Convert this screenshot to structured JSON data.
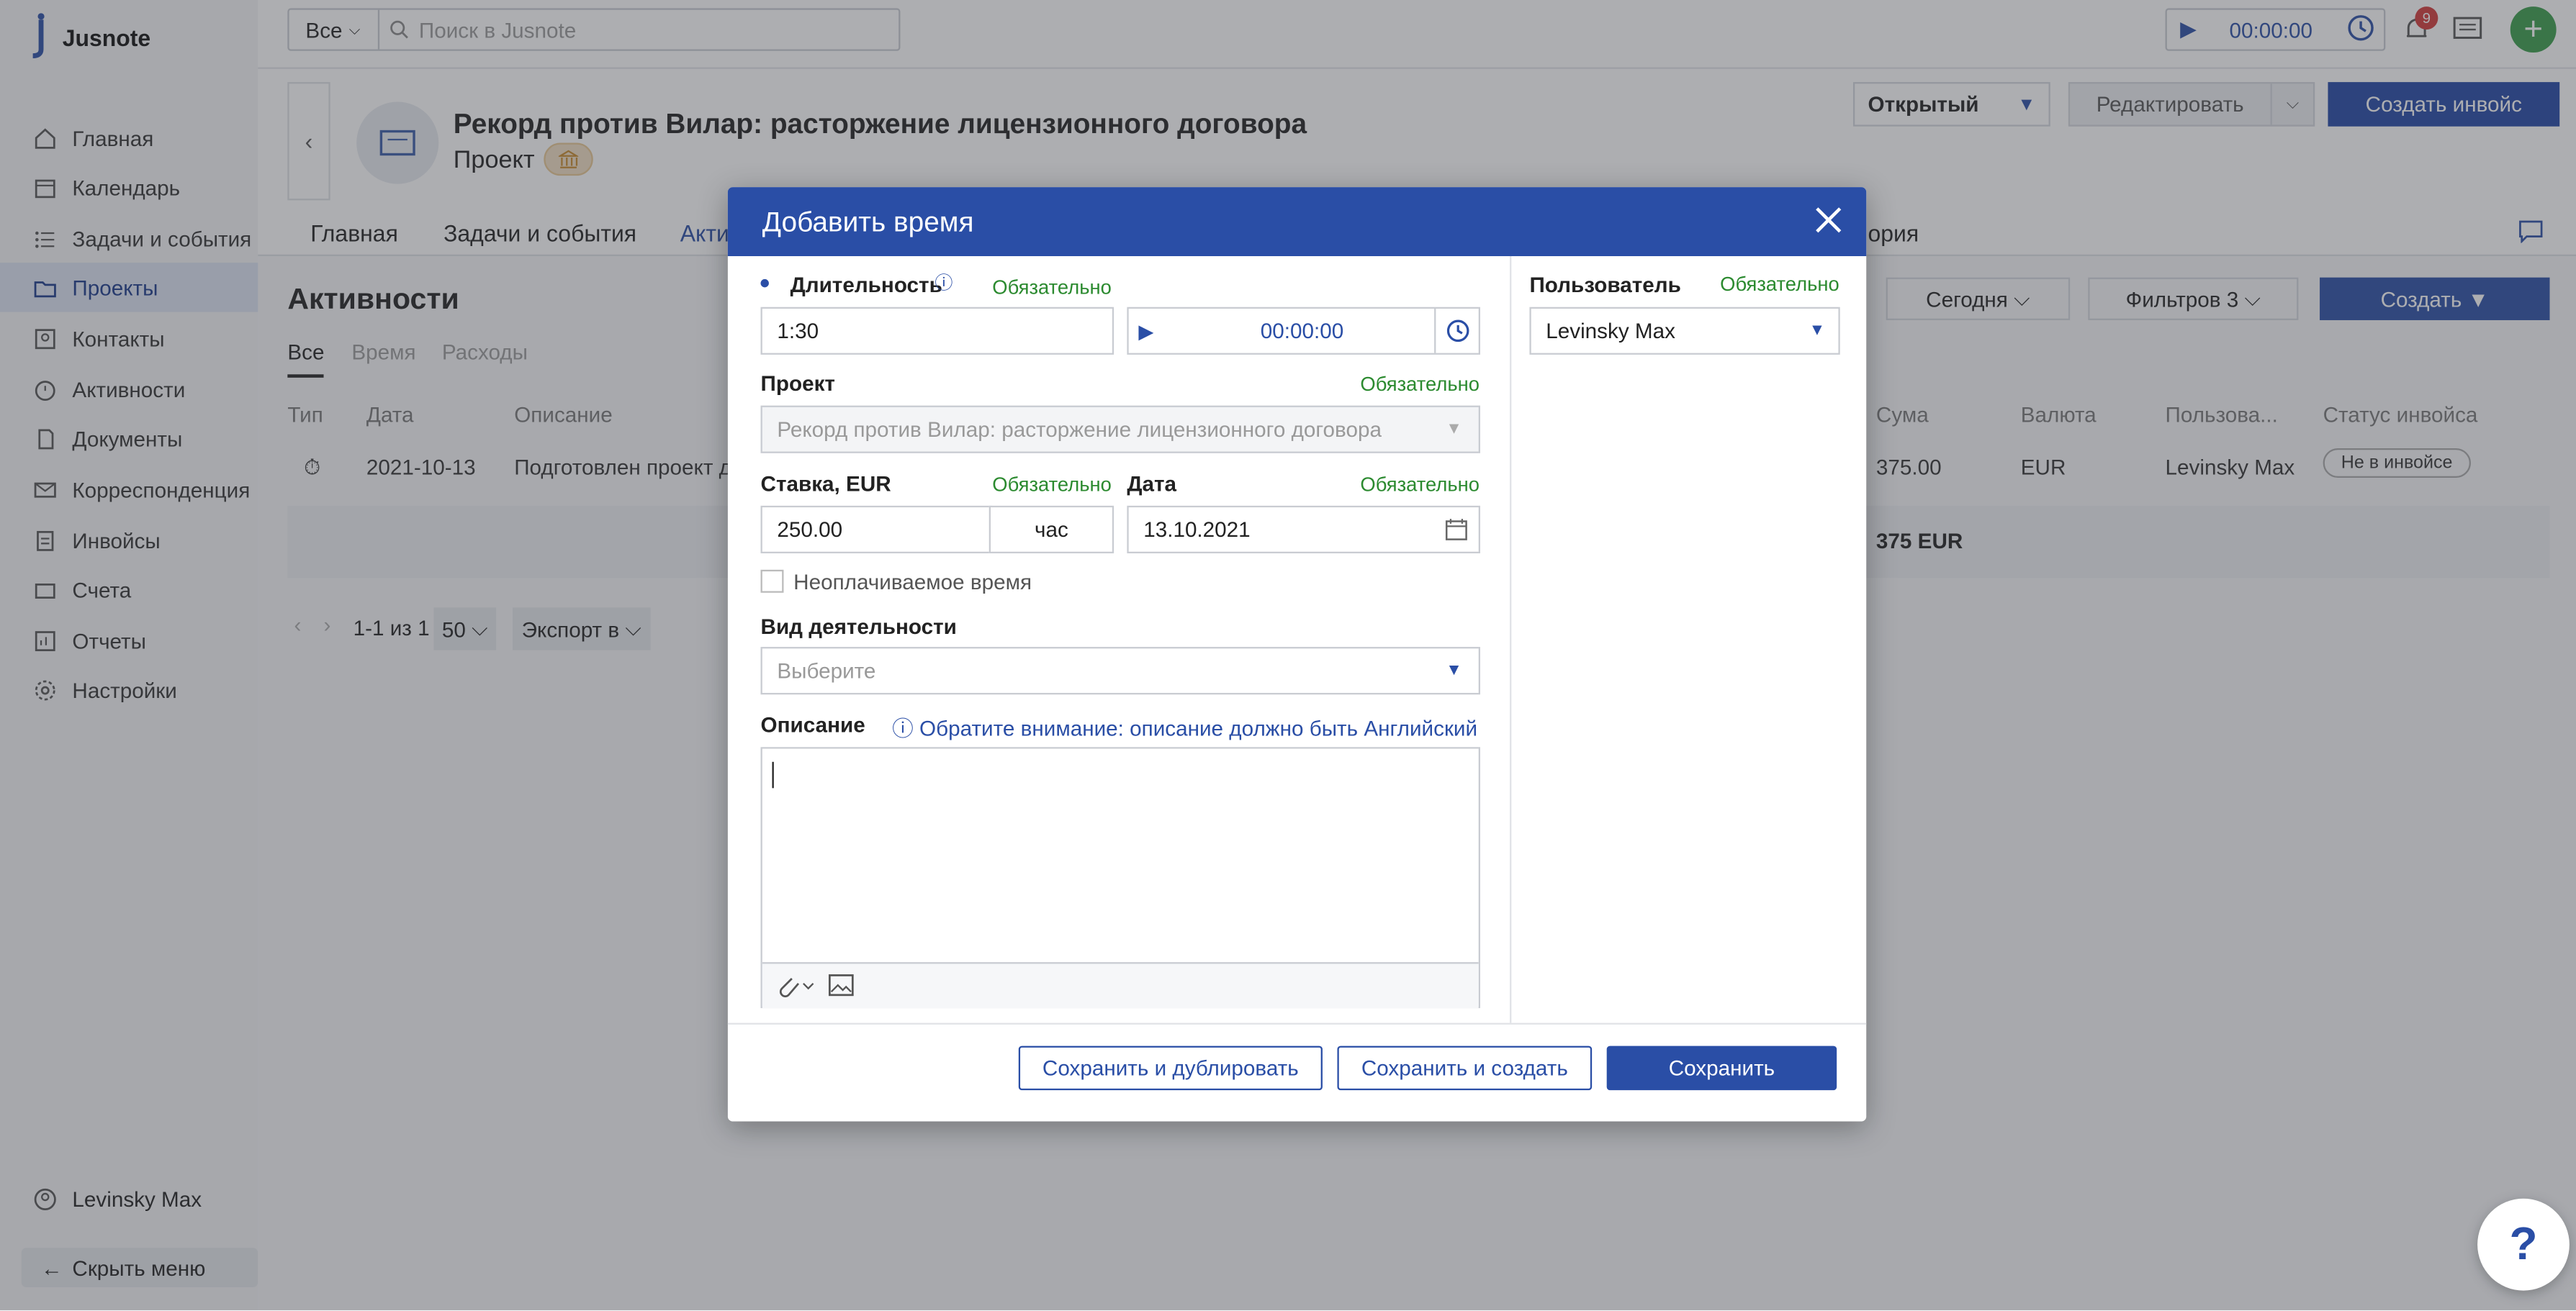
{
  "app": {
    "name": "Jusnote"
  },
  "sidebar": {
    "items": [
      {
        "label": "Главная",
        "icon": "home-icon"
      },
      {
        "label": "Календарь",
        "icon": "calendar-icon"
      },
      {
        "label": "Задачи и события",
        "icon": "tasks-icon"
      },
      {
        "label": "Проекты",
        "icon": "folder-icon"
      },
      {
        "label": "Контакты",
        "icon": "contacts-icon"
      },
      {
        "label": "Активности",
        "icon": "activity-icon"
      },
      {
        "label": "Документы",
        "icon": "documents-icon"
      },
      {
        "label": "Корреспонденция",
        "icon": "mail-icon"
      },
      {
        "label": "Инвойсы",
        "icon": "invoice-icon"
      },
      {
        "label": "Счета",
        "icon": "accounts-icon"
      },
      {
        "label": "Отчеты",
        "icon": "reports-icon"
      },
      {
        "label": "Настройки",
        "icon": "gear-icon"
      }
    ],
    "user": "Levinsky Max",
    "hide_menu": "Скрыть меню"
  },
  "topbar": {
    "search_scope": "Все",
    "search_placeholder": "Поиск в Jusnote",
    "timer": "00:00:00",
    "notifications_count": "9"
  },
  "project": {
    "title": "Рекорд против Вилар: расторжение лицензионного договора",
    "type": "Проект",
    "status": "Открытый",
    "edit_label": "Редактировать",
    "invoice_label": "Создать инвойс"
  },
  "tabs": [
    "Главная",
    "Задачи и события",
    "Акти",
    "ория"
  ],
  "activities": {
    "title": "Активности",
    "subtabs": [
      "Все",
      "Время",
      "Расходы"
    ],
    "today": "Сегодня",
    "filters": "Фильтров 3",
    "create": "Создать",
    "headers": {
      "type": "Тип",
      "date": "Дата",
      "description": "Описание",
      "sum": "Сума",
      "currency": "Валюта",
      "user": "Пользова...",
      "invoice_status": "Статус инвойса"
    },
    "row": {
      "date": "2021-10-13",
      "description": "Подготовлен проект д",
      "sum": "375.00",
      "currency": "EUR",
      "user": "Levinsky Max",
      "invoice_status": "Не в инвойсе"
    },
    "total": "375 EUR",
    "pager": {
      "range": "1-1 из 1",
      "per_page": "50",
      "export": "Экспорт в"
    }
  },
  "modal": {
    "title": "Добавить время",
    "required": "Обязательно",
    "duration_label": "Длительность",
    "duration_value": "1:30",
    "timer_value": "00:00:00",
    "project_label": "Проект",
    "project_value": "Рекорд против Вилар: расторжение лицензионного договора",
    "rate_label": "Ставка, EUR",
    "rate_value": "250.00",
    "rate_unit": "час",
    "date_label": "Дата",
    "date_value": "13.10.2021",
    "unpaid_label": "Неоплачиваемое время",
    "activity_label": "Вид деятельности",
    "activity_placeholder": "Выберите",
    "description_label": "Описание",
    "description_note": "Обратите внимание: описание должно быть Английский",
    "user_label": "Пользователь",
    "user_value": "Levinsky Max",
    "btn_save_dup": "Сохранить и дублировать",
    "btn_save_create": "Сохранить и создать",
    "btn_save": "Сохранить"
  },
  "help": "?"
}
